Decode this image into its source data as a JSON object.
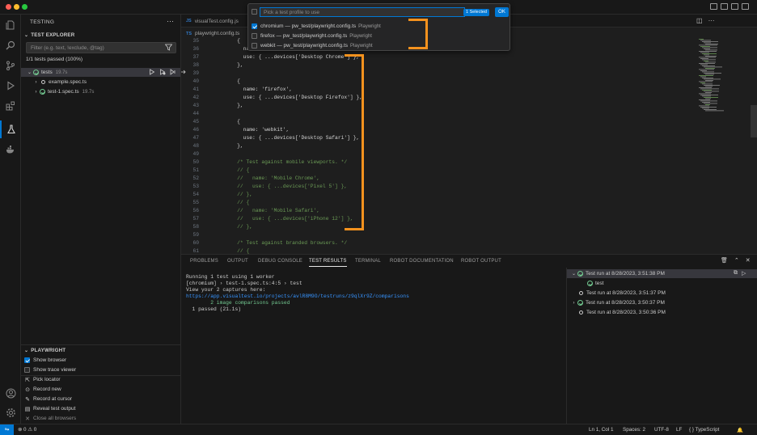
{
  "sidebar": {
    "title": "TESTING",
    "explorer_header": "TEST EXPLORER",
    "filter_placeholder": "Filter (e.g. text, !exclude, @tag)",
    "summary": "1/1 tests passed (100%)",
    "tree": [
      {
        "label": "tests",
        "duration": "19.7s"
      },
      {
        "label": "example.spec.ts",
        "duration": ""
      },
      {
        "label": "test-1.spec.ts",
        "duration": "19.7s"
      }
    ],
    "playwright": {
      "header": "PLAYWRIGHT",
      "options": [
        {
          "label": "Show browser",
          "checked": true
        },
        {
          "label": "Show trace viewer",
          "checked": false
        }
      ],
      "actions": [
        "Pick locator",
        "Record new",
        "Record at cursor",
        "Reveal test output",
        "Close all browsers"
      ]
    }
  },
  "editor": {
    "tab_label": "visualTest.config.js",
    "breadcrumb": "playwright.config.ts",
    "lines": [
      {
        "n": "35",
        "t": "    {"
      },
      {
        "n": "36",
        "t": "      name: 'chromium',"
      },
      {
        "n": "37",
        "t": "      use: { ...devices['Desktop Chrome'] },"
      },
      {
        "n": "38",
        "t": "    },"
      },
      {
        "n": "39",
        "t": ""
      },
      {
        "n": "40",
        "t": "    {"
      },
      {
        "n": "41",
        "t": "      name: 'firefox',"
      },
      {
        "n": "42",
        "t": "      use: { ...devices['Desktop Firefox'] },"
      },
      {
        "n": "43",
        "t": "    },"
      },
      {
        "n": "44",
        "t": ""
      },
      {
        "n": "45",
        "t": "    {"
      },
      {
        "n": "46",
        "t": "      name: 'webkit',"
      },
      {
        "n": "47",
        "t": "      use: { ...devices['Desktop Safari'] },"
      },
      {
        "n": "48",
        "t": "    },"
      },
      {
        "n": "49",
        "t": ""
      },
      {
        "n": "50",
        "t": "    /* Test against mobile viewports. */"
      },
      {
        "n": "51",
        "t": "    // {"
      },
      {
        "n": "52",
        "t": "    //   name: 'Mobile Chrome',"
      },
      {
        "n": "53",
        "t": "    //   use: { ...devices['Pixel 5'] },"
      },
      {
        "n": "54",
        "t": "    // },"
      },
      {
        "n": "55",
        "t": "    // {"
      },
      {
        "n": "56",
        "t": "    //   name: 'Mobile Safari',"
      },
      {
        "n": "57",
        "t": "    //   use: { ...devices['iPhone 12'] },"
      },
      {
        "n": "58",
        "t": "    // },"
      },
      {
        "n": "59",
        "t": ""
      },
      {
        "n": "60",
        "t": "    /* Test against branded browsers. */"
      },
      {
        "n": "61",
        "t": "    // {"
      }
    ]
  },
  "quickpick": {
    "placeholder": "Pick a test profile to use",
    "badge": "1 Selected",
    "ok": "OK",
    "items": [
      {
        "label": "chromium — pw_test/playwright.config.ts",
        "desc": "Playwright",
        "checked": true
      },
      {
        "label": "firefox — pw_test/playwright.config.ts",
        "desc": "Playwright",
        "checked": false
      },
      {
        "label": "webkit — pw_test/playwright.config.ts",
        "desc": "Playwright",
        "checked": false
      }
    ]
  },
  "panel": {
    "tabs": [
      "PROBLEMS",
      "OUTPUT",
      "DEBUG CONSOLE",
      "TEST RESULTS",
      "TERMINAL",
      "ROBOT DOCUMENTATION",
      "ROBOT OUTPUT"
    ],
    "active_tab": "TEST RESULTS",
    "output": [
      "Running 1 test using 1 worker",
      "[chromium] › test-1.spec.ts:4:5 › test",
      "View your 2 captures here:",
      "https://app.visualtest.io/projects/avlR8M9O/testruns/z9qlXr9Z/comparisons",
      "        2 image comparisons passed",
      "  1 passed (21.1s)"
    ],
    "runs": [
      {
        "label": "Test run at 8/28/2023, 3:51:38 PM",
        "status": "passed",
        "expanded": true
      },
      {
        "label": "test",
        "status": "passed",
        "child": true
      },
      {
        "label": "Test run at 8/28/2023, 3:51:37 PM",
        "status": "none"
      },
      {
        "label": "Test run at 8/28/2023, 3:50:37 PM",
        "status": "passed",
        "expanded": false
      },
      {
        "label": "Test run at 8/28/2023, 3:50:36 PM",
        "status": "none"
      }
    ]
  },
  "statusbar": {
    "errors": "0",
    "warnings": "0",
    "position": "Ln 1, Col 1",
    "spaces": "Spaces: 2",
    "encoding": "UTF-8",
    "eol": "LF",
    "language": "TypeScript"
  },
  "colors": {
    "accent": "#0078d4",
    "pass": "#73c991",
    "highlight": "#f5921e"
  }
}
